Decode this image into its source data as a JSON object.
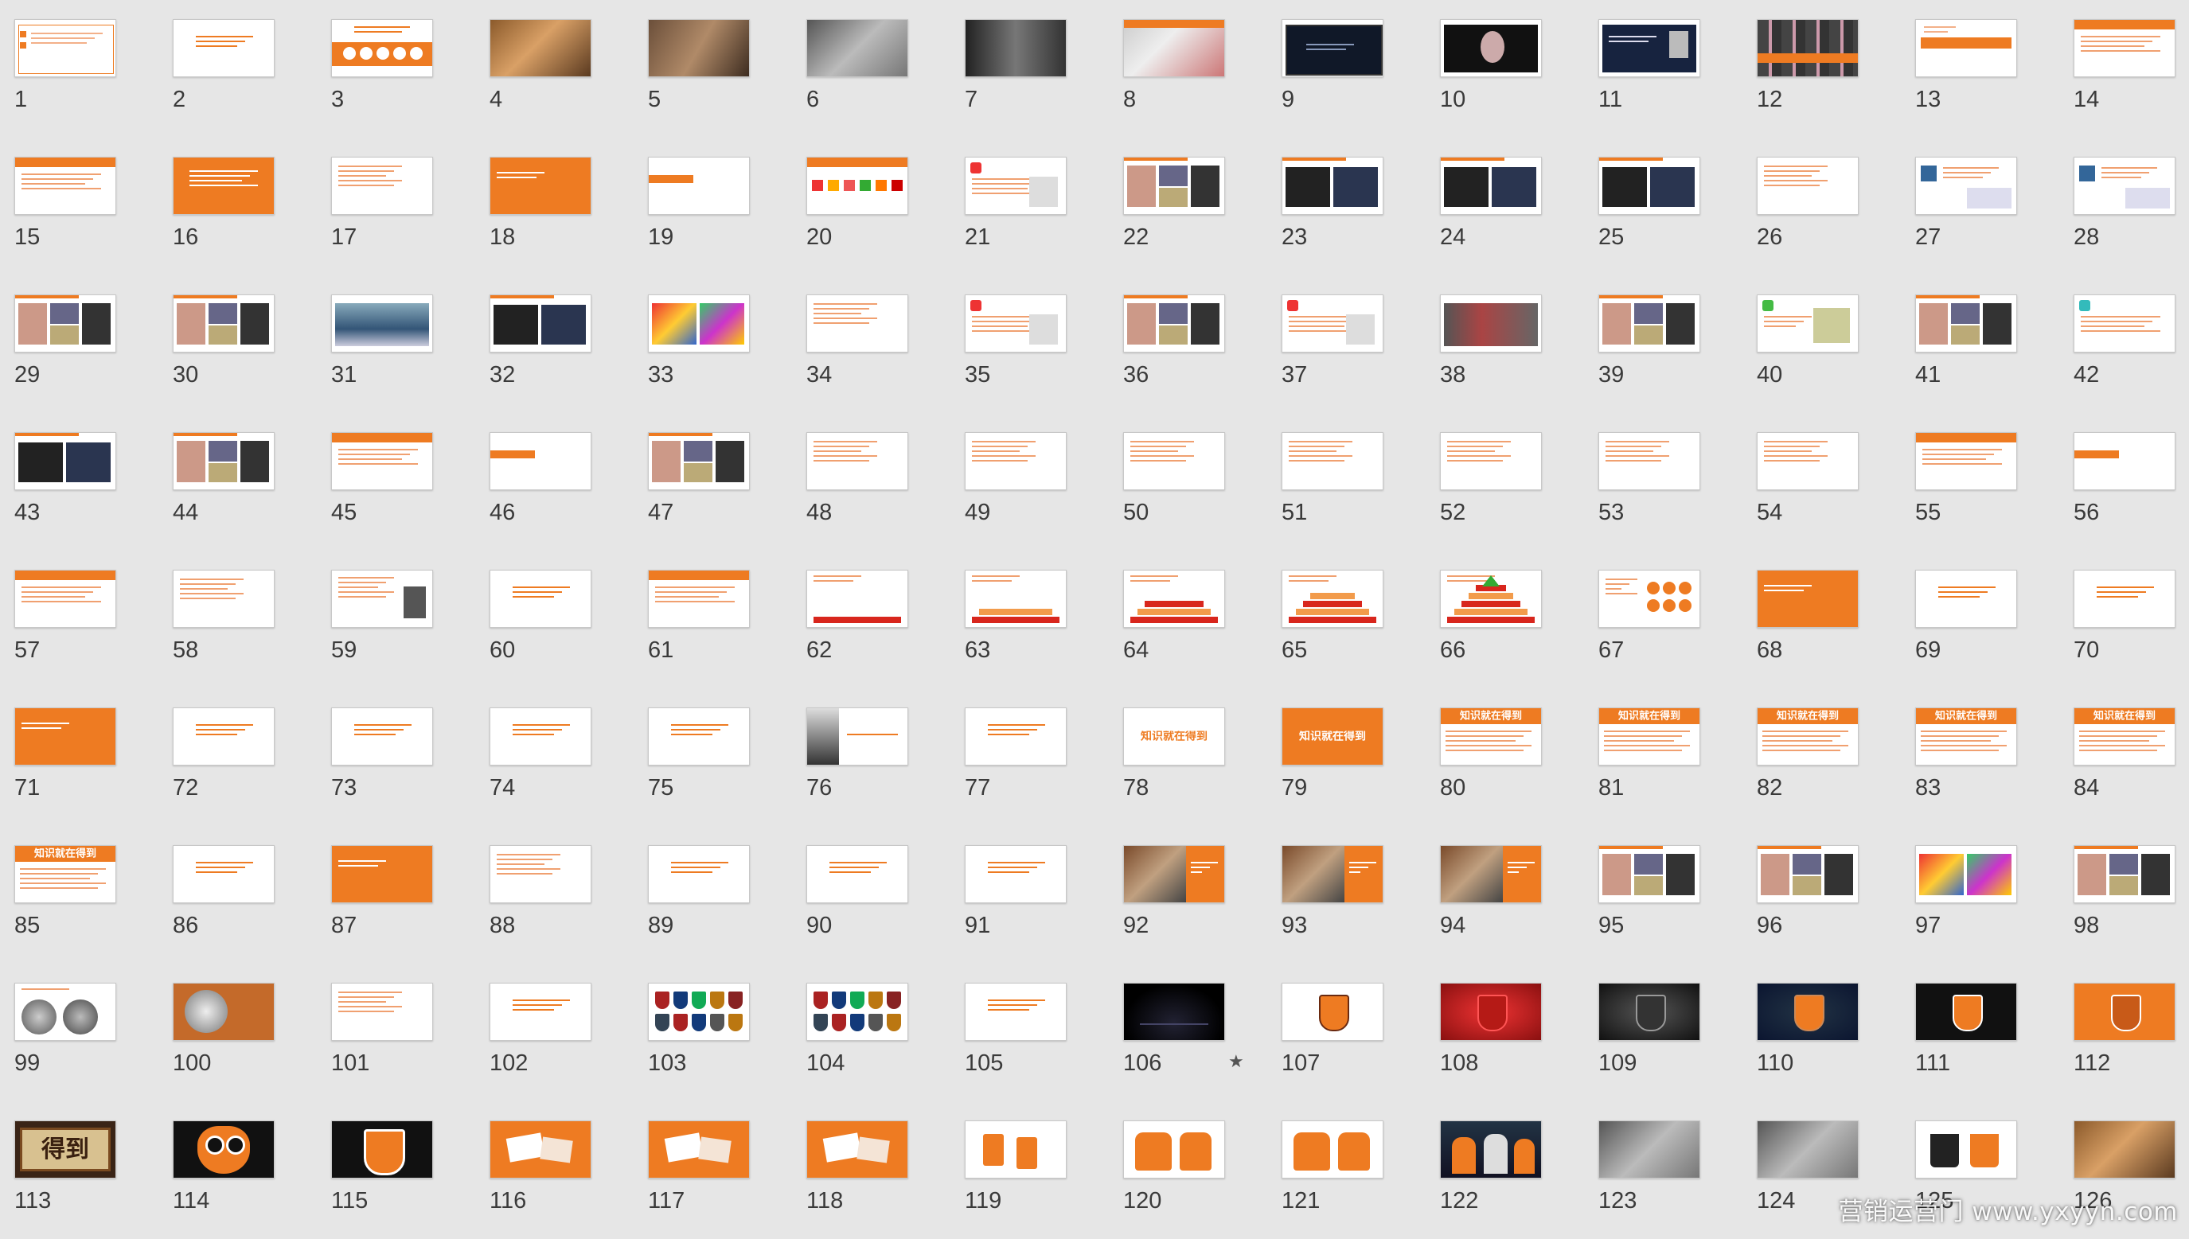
{
  "app": {
    "view": "slide-sorter"
  },
  "watermark": "营销运营门 www.yxyyn.com",
  "colors": {
    "orange": "#ee7b22",
    "white": "#ffffff",
    "dark": "#1a1a1a",
    "navy": "#16244a",
    "red": "#c9221e",
    "grey": "#8f8f8f",
    "bg": "#e6e6e6"
  },
  "grid": {
    "columns": 14,
    "rows": 9
  },
  "slides": [
    {
      "n": "1",
      "style": "text-frame"
    },
    {
      "n": "2",
      "style": "text-center"
    },
    {
      "n": "3",
      "style": "orange-band-circles"
    },
    {
      "n": "4",
      "style": "photo-warm"
    },
    {
      "n": "5",
      "style": "photo-sepia"
    },
    {
      "n": "6",
      "style": "photo-grey"
    },
    {
      "n": "7",
      "style": "photo-dark"
    },
    {
      "n": "8",
      "style": "photo-orange-top"
    },
    {
      "n": "9",
      "style": "screen-dark"
    },
    {
      "n": "10",
      "style": "screen-dark-face"
    },
    {
      "n": "11",
      "style": "screen-navy"
    },
    {
      "n": "12",
      "style": "people-grid"
    },
    {
      "n": "13",
      "style": "orange-bar-text"
    },
    {
      "n": "14",
      "style": "orange-header-text"
    },
    {
      "n": "15",
      "style": "orange-header-text"
    },
    {
      "n": "16",
      "style": "orange-full-text"
    },
    {
      "n": "17",
      "style": "text-lines"
    },
    {
      "n": "18",
      "style": "orange-full-left"
    },
    {
      "n": "19",
      "style": "text-tag"
    },
    {
      "n": "20",
      "style": "orange-header-icons"
    },
    {
      "n": "21",
      "style": "text-red-icon"
    },
    {
      "n": "22",
      "style": "collage"
    },
    {
      "n": "23",
      "style": "collage-dark"
    },
    {
      "n": "24",
      "style": "collage-dark"
    },
    {
      "n": "25",
      "style": "collage-dark"
    },
    {
      "n": "26",
      "style": "text-lines"
    },
    {
      "n": "27",
      "style": "text-screens"
    },
    {
      "n": "28",
      "style": "text-screens"
    },
    {
      "n": "29",
      "style": "collage"
    },
    {
      "n": "30",
      "style": "collage"
    },
    {
      "n": "31",
      "style": "photo-blue"
    },
    {
      "n": "32",
      "style": "collage-dark"
    },
    {
      "n": "33",
      "style": "collage-color"
    },
    {
      "n": "34",
      "style": "text-lines"
    },
    {
      "n": "35",
      "style": "text-red-icon"
    },
    {
      "n": "36",
      "style": "collage"
    },
    {
      "n": "37",
      "style": "text-red-icon"
    },
    {
      "n": "38",
      "style": "photo-wide-grey"
    },
    {
      "n": "39",
      "style": "collage"
    },
    {
      "n": "40",
      "style": "text-green-icon"
    },
    {
      "n": "41",
      "style": "collage"
    },
    {
      "n": "42",
      "style": "text-cyan-icon"
    },
    {
      "n": "43",
      "style": "collage-dark"
    },
    {
      "n": "44",
      "style": "collage"
    },
    {
      "n": "45",
      "style": "orange-header-text"
    },
    {
      "n": "46",
      "style": "text-tag"
    },
    {
      "n": "47",
      "style": "collage"
    },
    {
      "n": "48",
      "style": "text-lines"
    },
    {
      "n": "49",
      "style": "text-lines"
    },
    {
      "n": "50",
      "style": "text-lines"
    },
    {
      "n": "51",
      "style": "text-lines"
    },
    {
      "n": "52",
      "style": "text-lines"
    },
    {
      "n": "53",
      "style": "text-lines"
    },
    {
      "n": "54",
      "style": "text-lines"
    },
    {
      "n": "55",
      "style": "orange-header-text"
    },
    {
      "n": "56",
      "style": "text-tag"
    },
    {
      "n": "57",
      "style": "orange-header-text"
    },
    {
      "n": "58",
      "style": "text-lines"
    },
    {
      "n": "59",
      "style": "text-portrait"
    },
    {
      "n": "60",
      "style": "text-center"
    },
    {
      "n": "61",
      "style": "orange-header-text"
    },
    {
      "n": "62",
      "style": "pyramid-1"
    },
    {
      "n": "63",
      "style": "pyramid-2"
    },
    {
      "n": "64",
      "style": "pyramid-3"
    },
    {
      "n": "65",
      "style": "pyramid-4"
    },
    {
      "n": "66",
      "style": "pyramid-5"
    },
    {
      "n": "67",
      "style": "text-circles"
    },
    {
      "n": "68",
      "style": "orange-full-left"
    },
    {
      "n": "69",
      "style": "text-center"
    },
    {
      "n": "70",
      "style": "text-center"
    },
    {
      "n": "71",
      "style": "orange-full-left"
    },
    {
      "n": "72",
      "style": "text-center"
    },
    {
      "n": "73",
      "style": "text-center"
    },
    {
      "n": "74",
      "style": "text-center"
    },
    {
      "n": "75",
      "style": "text-center"
    },
    {
      "n": "76",
      "style": "portrait-title"
    },
    {
      "n": "77",
      "style": "text-center"
    },
    {
      "n": "78",
      "style": "title-white",
      "title": "知识就在得到"
    },
    {
      "n": "79",
      "style": "title-orange",
      "title": "知识就在得到"
    },
    {
      "n": "80",
      "style": "title-header",
      "title": "知识就在得到"
    },
    {
      "n": "81",
      "style": "title-header",
      "title": "知识就在得到"
    },
    {
      "n": "82",
      "style": "title-header",
      "title": "知识就在得到"
    },
    {
      "n": "83",
      "style": "title-header",
      "title": "知识就在得到"
    },
    {
      "n": "84",
      "style": "title-header",
      "title": "知识就在得到"
    },
    {
      "n": "85",
      "style": "title-header",
      "title": "知识就在得到"
    },
    {
      "n": "86",
      "style": "text-center"
    },
    {
      "n": "87",
      "style": "orange-full-left"
    },
    {
      "n": "88",
      "style": "text-lines"
    },
    {
      "n": "89",
      "style": "text-center"
    },
    {
      "n": "90",
      "style": "text-center"
    },
    {
      "n": "91",
      "style": "text-center"
    },
    {
      "n": "92",
      "style": "photo-orange-right"
    },
    {
      "n": "93",
      "style": "photo-orange-right"
    },
    {
      "n": "94",
      "style": "photo-orange-right"
    },
    {
      "n": "95",
      "style": "collage"
    },
    {
      "n": "96",
      "style": "collage"
    },
    {
      "n": "97",
      "style": "collage-color"
    },
    {
      "n": "98",
      "style": "collage"
    },
    {
      "n": "99",
      "style": "coins"
    },
    {
      "n": "100",
      "style": "coin-orange"
    },
    {
      "n": "101",
      "style": "text-lines"
    },
    {
      "n": "102",
      "style": "text-center"
    },
    {
      "n": "103",
      "style": "crests"
    },
    {
      "n": "104",
      "style": "crests"
    },
    {
      "n": "105",
      "style": "text-center"
    },
    {
      "n": "106",
      "style": "black-stars",
      "star": "★"
    },
    {
      "n": "107",
      "style": "badge-white"
    },
    {
      "n": "108",
      "style": "badge-red"
    },
    {
      "n": "109",
      "style": "badge-black"
    },
    {
      "n": "110",
      "style": "badge-navy"
    },
    {
      "n": "111",
      "style": "badge-dark"
    },
    {
      "n": "112",
      "style": "badge-orange"
    },
    {
      "n": "113",
      "style": "sign-board",
      "title": "得到"
    },
    {
      "n": "114",
      "style": "owl-black"
    },
    {
      "n": "115",
      "style": "badge-black2"
    },
    {
      "n": "116",
      "style": "mockup-orange"
    },
    {
      "n": "117",
      "style": "mockup-orange"
    },
    {
      "n": "118",
      "style": "mockup-orange"
    },
    {
      "n": "119",
      "style": "mockup-white"
    },
    {
      "n": "120",
      "style": "merch-white"
    },
    {
      "n": "121",
      "style": "merch-white"
    },
    {
      "n": "122",
      "style": "people-dark"
    },
    {
      "n": "123",
      "style": "photo-grey"
    },
    {
      "n": "124",
      "style": "photo-grey"
    },
    {
      "n": "125",
      "style": "mugs"
    },
    {
      "n": "126",
      "style": "photo-warm"
    }
  ]
}
